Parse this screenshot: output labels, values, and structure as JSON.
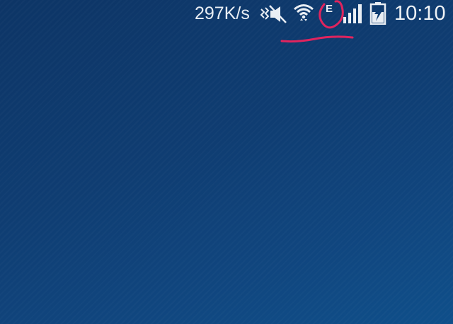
{
  "status_bar": {
    "network_speed": "297K/s",
    "data_type_indicator": "E",
    "clock": "10:10",
    "icons": [
      "vibrate-mute-icon",
      "wifi-icon",
      "edge-network-icon",
      "signal-bars-icon",
      "battery-charging-icon"
    ]
  },
  "annotation": {
    "color": "#e0245e"
  },
  "colors": {
    "wallpaper": "#0f3f74",
    "status_text": "#e9eef4"
  }
}
